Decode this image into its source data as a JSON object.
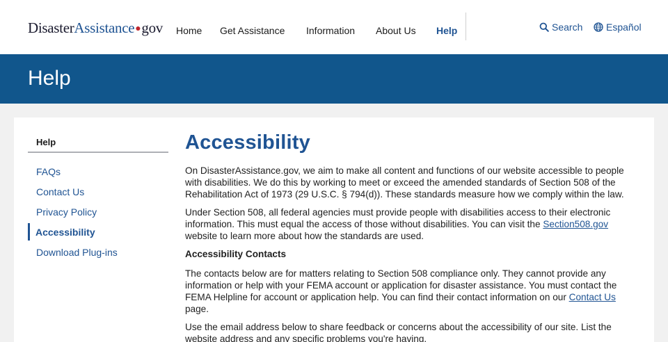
{
  "header": {
    "logo": {
      "part1": "Disaster",
      "part2": "Assistance",
      "dot": "●",
      "part3": "gov"
    },
    "nav": [
      "Home",
      "Get Assistance",
      "Information",
      "About Us",
      "Help"
    ],
    "active_nav": "Help",
    "search_label": "Search",
    "language_label": "Español"
  },
  "banner": {
    "title": "Help"
  },
  "sidebar": {
    "title": "Help",
    "items": [
      "FAQs",
      "Contact Us",
      "Privacy Policy",
      "Accessibility",
      "Download Plug-ins"
    ],
    "current": "Accessibility"
  },
  "content": {
    "heading": "Accessibility",
    "p1": "On DisasterAssistance.gov, we aim to make all content and functions of our website accessible to people with disabilities. We do this by working to meet or exceed the amended standards of Section 508 of the Rehabilitation Act of 1973 (29 U.S.C. § 794(d)). These standards measure how we comply within the law.",
    "p2_before": "Under Section 508, all federal agencies must provide people with disabilities access to their electronic information. This must equal the access of those without disabilities. You can visit the ",
    "p2_link": "Section508.gov",
    "p2_after": " website to learn more about how the standards are used.",
    "subheading": "Accessibility Contacts",
    "p3_before": "The contacts below are for matters relating to Section 508 compliance only. They cannot provide any information or help with your FEMA account or application for disaster assistance. You must contact the FEMA Helpline for account or application help. You can find their contact information on our ",
    "p3_link": "Contact Us",
    "p3_after": " page.",
    "p4": "Use the email address below to share feedback or concerns about the accessibility of our site. List the website address and any specific problems you're having."
  },
  "colors": {
    "brand_blue": "#205493",
    "banner_blue": "#11568c",
    "logo_dot": "#c0262d"
  }
}
